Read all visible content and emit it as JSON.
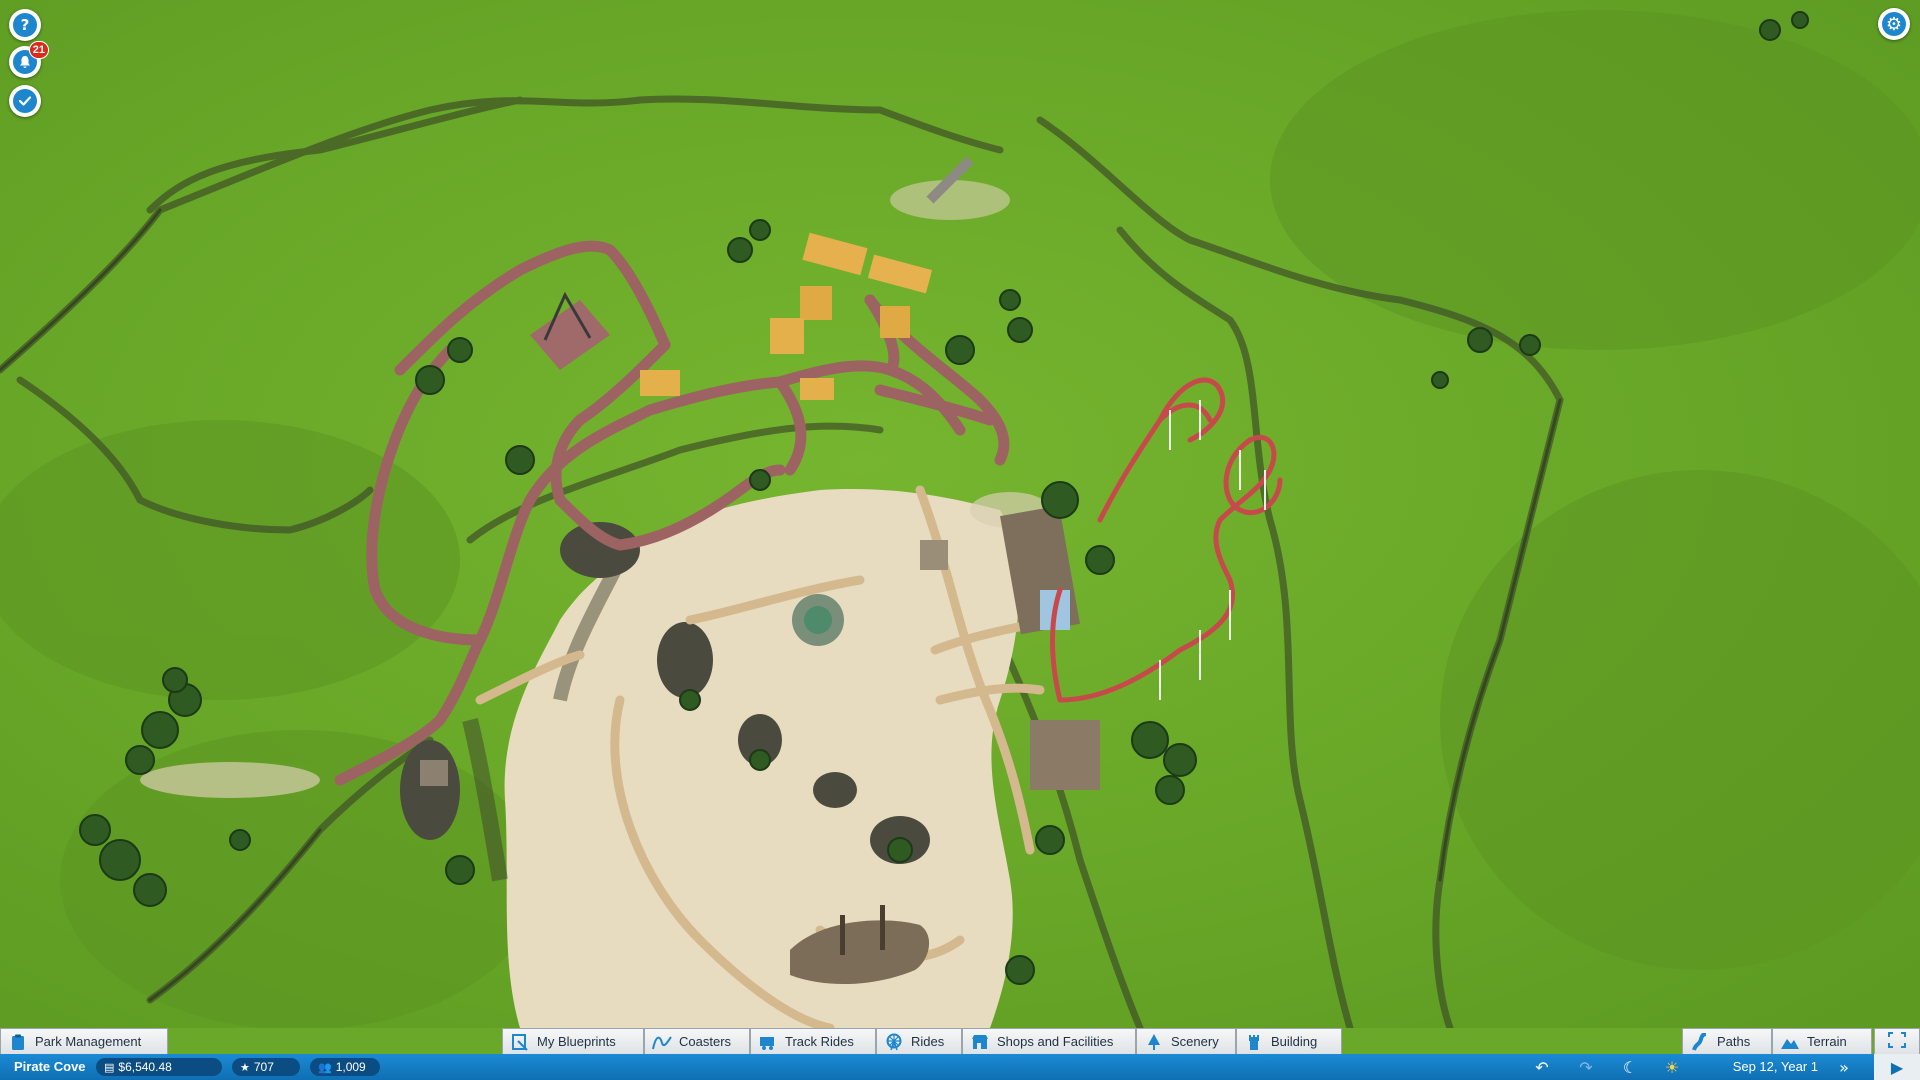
{
  "hud": {
    "help_icon": "question-mark",
    "notifications_count": "21",
    "objectives_icon": "checkmark",
    "settings_icon": "gear"
  },
  "toolbar": {
    "park_management": "Park Management",
    "my_blueprints": "My Blueprints",
    "coasters": "Coasters",
    "track_rides": "Track Rides",
    "rides": "Rides",
    "shops": "Shops and Facilities",
    "scenery": "Scenery",
    "building": "Building",
    "paths": "Paths",
    "terrain": "Terrain"
  },
  "status": {
    "park_name": "Pirate Cove",
    "money": "$6,540.48",
    "rating": "707",
    "guests": "1,009",
    "date": "Sep 12, Year 1"
  },
  "colors": {
    "grass": "#6aa82a",
    "sand": "#e6d8bc",
    "path": "#a06a6a",
    "toolbar_blue": "#1b8ad4",
    "coaster_track": "#c8494c"
  }
}
